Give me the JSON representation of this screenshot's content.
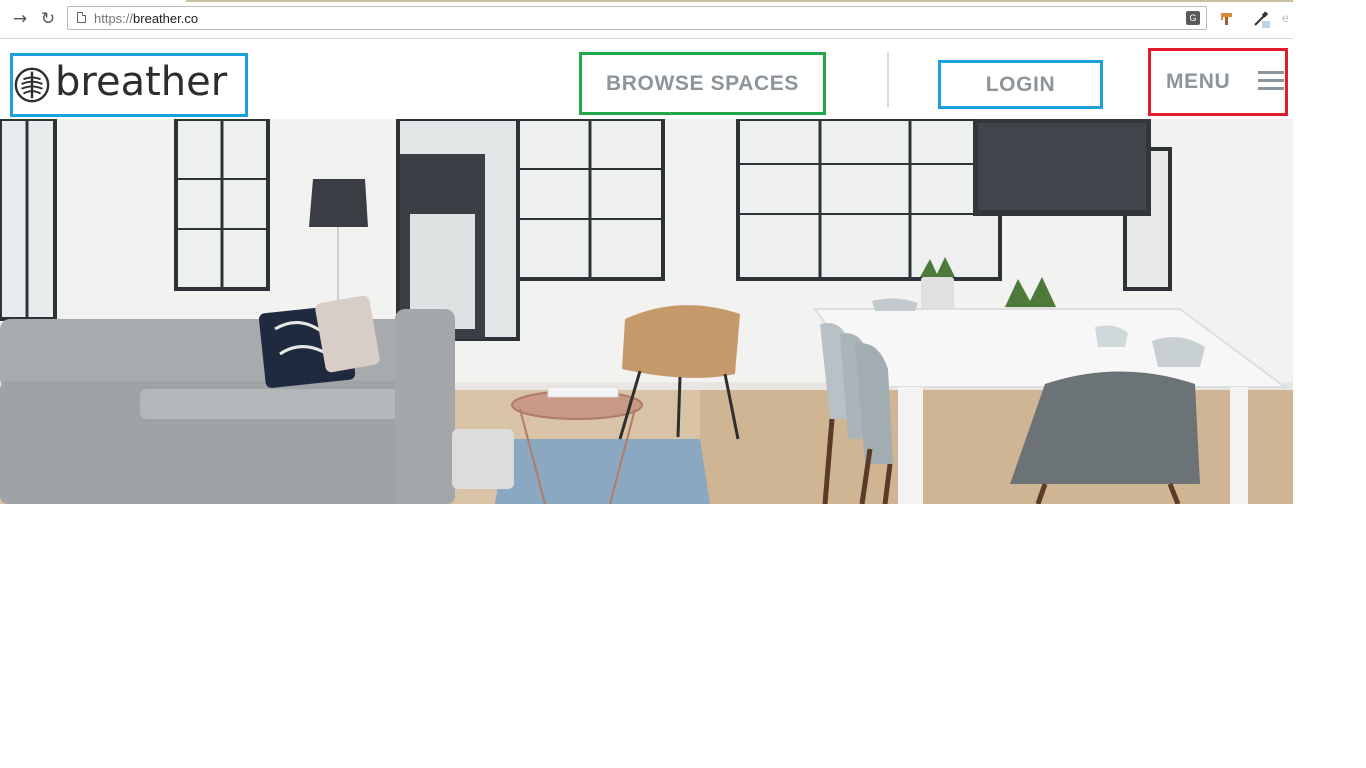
{
  "browser": {
    "url_scheme": "https://",
    "url_host": "breather.co",
    "translate_icon": "translate-icon",
    "extension_icons": [
      "paint-brush-icon",
      "eyedropper-icon"
    ]
  },
  "header": {
    "logo_text": "breather",
    "logo_icon": "breather-leaf-icon",
    "browse_label": "BROWSE SPACES",
    "login_label": "LOGIN",
    "menu_label": "MENU",
    "menu_icon": "hamburger-icon"
  },
  "colors": {
    "nav_text": "#8c959b",
    "logo_box_outline": "#1ba1dc",
    "browse_box_outline": "#22a84a",
    "login_box_outline": "#1ba1dc",
    "menu_box_outline": "#e21c2c"
  },
  "hero": {
    "image": "living-room-and-meeting-table-photo"
  }
}
